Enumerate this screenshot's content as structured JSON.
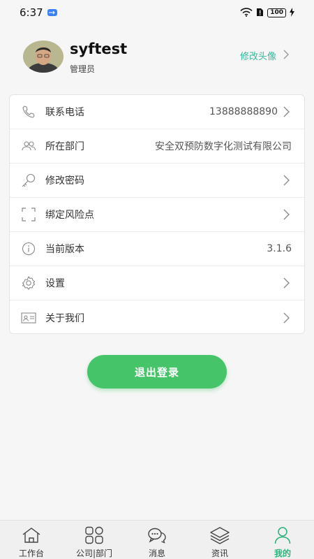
{
  "status_bar": {
    "time": "6:37",
    "battery": "100"
  },
  "profile": {
    "username": "syftest",
    "role": "管理员",
    "change_avatar_label": "修改头像"
  },
  "menu": {
    "items": [
      {
        "label": "联系电话",
        "value": "13888888890",
        "icon": "phone-icon",
        "chevron": true
      },
      {
        "label": "所在部门",
        "value": "安全双预防数字化测试有限公司",
        "icon": "users-icon",
        "chevron": false
      },
      {
        "label": "修改密码",
        "value": "",
        "icon": "key-icon",
        "chevron": true
      },
      {
        "label": "绑定风险点",
        "value": "",
        "icon": "scan-icon",
        "chevron": true
      },
      {
        "label": "当前版本",
        "value": "3.1.6",
        "icon": "info-icon",
        "chevron": false
      },
      {
        "label": "设置",
        "value": "",
        "icon": "gear-icon",
        "chevron": true
      },
      {
        "label": "关于我们",
        "value": "",
        "icon": "id-card-icon",
        "chevron": true
      }
    ]
  },
  "logout_label": "退出登录",
  "tab_bar": {
    "tabs": [
      {
        "label": "工作台",
        "icon": "home-icon"
      },
      {
        "label": "公司|部门",
        "icon": "grid-icon"
      },
      {
        "label": "消息",
        "icon": "chat-icon"
      },
      {
        "label": "资讯",
        "icon": "layers-icon"
      },
      {
        "label": "我的",
        "icon": "person-icon",
        "active": true
      }
    ]
  },
  "colors": {
    "accent": "#46c46a",
    "link": "#35b89c",
    "active_tab": "#2eb27c"
  }
}
